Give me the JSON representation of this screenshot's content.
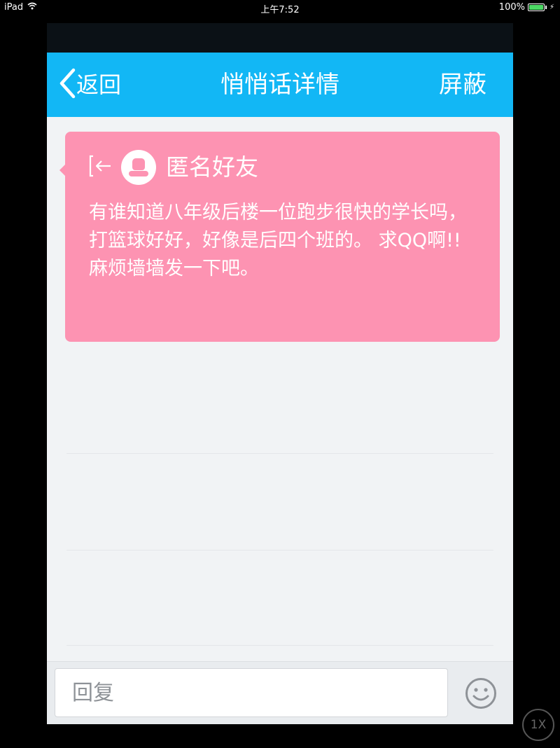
{
  "status_bar": {
    "device": "iPad",
    "time": "上午7:52",
    "battery": "100%",
    "battery_level": 1.0
  },
  "navbar": {
    "back_label": "返回",
    "title": "悄悄话详情",
    "right_label": "屏蔽",
    "background_color": "#12b7f5"
  },
  "message_card": {
    "sender": "匿名好友",
    "text": "有谁知道八年级后楼一位跑步很快的学长吗，打篮球好好，好像是后四个班的。 求QQ啊!! 麻烦墙墙发一下吧。",
    "background_color": "#fd93b2"
  },
  "reply_bar": {
    "placeholder": "回复"
  },
  "zoom": {
    "label": "1X"
  }
}
